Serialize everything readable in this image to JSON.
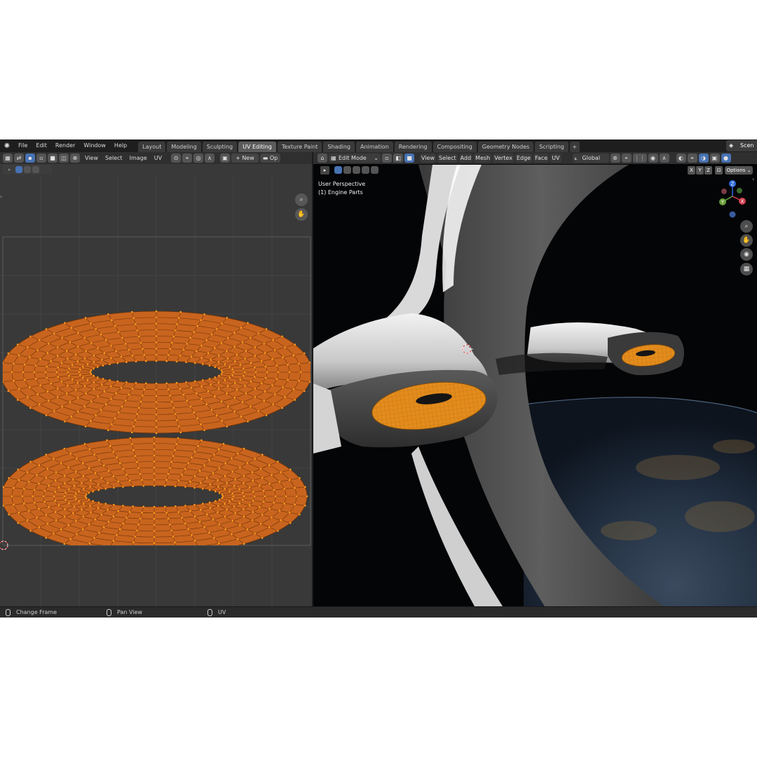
{
  "menu": {
    "items": [
      "File",
      "Edit",
      "Render",
      "Window",
      "Help"
    ]
  },
  "workspaces": {
    "tabs": [
      "Layout",
      "Modeling",
      "Sculpting",
      "UV Editing",
      "Texture Paint",
      "Shading",
      "Animation",
      "Rendering",
      "Compositing",
      "Geometry Nodes",
      "Scripting"
    ],
    "active": "UV Editing",
    "add": "+"
  },
  "scene": {
    "label": "Scen"
  },
  "uv_editor": {
    "menus": [
      "View",
      "Select",
      "Image",
      "UV"
    ],
    "new_label": "New",
    "open_label": "Op"
  },
  "viewport": {
    "mode_label": "Edit Mode",
    "menus": [
      "View",
      "Select",
      "Add",
      "Mesh",
      "Vertex",
      "Edge",
      "Face",
      "UV"
    ],
    "transform_orientation": "Global",
    "perspective_label": "User Perspective",
    "object_label": "(1) Engine Parts",
    "axes": [
      "X",
      "Y",
      "Z"
    ],
    "options_label": "Options",
    "gizmo_axes": [
      "Z",
      "Y",
      "X"
    ]
  },
  "status_bar": {
    "items": [
      "Change Frame",
      "Pan View",
      "UV"
    ]
  },
  "colors": {
    "uv_fill": "#c8641e",
    "uv_vertex": "#ff9a1f",
    "accent": "#4772b3",
    "active_tab": "#5b5b5b"
  }
}
